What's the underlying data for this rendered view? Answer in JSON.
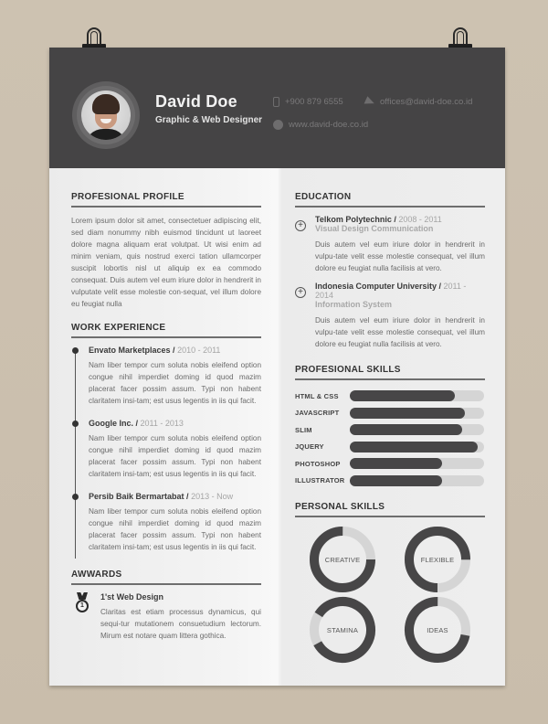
{
  "header": {
    "name": "David Doe",
    "role": "Graphic & Web Designer",
    "phone": "+900 879 6555",
    "email": "offices@david-doe.co.id",
    "website": "www.david-doe.co.id",
    "icons": {
      "phone": "mobile-phone-icon",
      "email": "paper-plane-icon",
      "website": "globe-icon"
    }
  },
  "profile": {
    "title": "PROFESIONAL PROFILE",
    "text": "Lorem ipsum dolor sit amet, consectetuer adipiscing elit, sed diam nonummy nibh euismod tincidunt ut laoreet dolore magna aliquam erat volutpat. Ut wisi enim ad minim veniam, quis nostrud exerci tation ullamcorper suscipit lobortis nisl ut aliquip ex ea commodo consequat. Duis autem vel eum iriure dolor in hendrerit in vulputate velit esse molestie con-sequat, vel illum dolore eu feugiat nulla"
  },
  "work": {
    "title": "WORK EXPERIENCE",
    "items": [
      {
        "company": "Envato Marketplaces",
        "years": "2010 - 2011",
        "text": "Nam liber tempor cum soluta nobis eleifend option congue nihil imperdiet doming id quod mazim placerat facer possim assum. Typi non habent claritatem insi-tam; est usus legentis in iis qui facit."
      },
      {
        "company": "Google Inc.",
        "years": "2011 - 2013",
        "text": "Nam liber tempor cum soluta nobis eleifend option congue nihil imperdiet doming id quod mazim placerat facer possim assum. Typi non habent claritatem insi-tam; est usus legentis in iis qui facit."
      },
      {
        "company": "Persib Baik Bermartabat",
        "years": "2013 - Now",
        "text": "Nam liber tempor cum soluta nobis eleifend option congue nihil imperdiet doming id quod mazim placerat facer possim assum. Typi non habent claritatem insi-tam; est usus legentis in iis qui facit."
      }
    ],
    "separator": " / "
  },
  "awards": {
    "title": "AWWARDS",
    "items": [
      {
        "title": "1'st Web Design",
        "medal_number": "1",
        "text": "Claritas est etiam processus dynamicus, qui sequi-tur mutationem consuetudium lectorum. Mirum est notare quam littera gothica."
      }
    ]
  },
  "education": {
    "title": "EDUCATION",
    "items": [
      {
        "school": "Telkom Polytechnic",
        "years": "2008 - 2011",
        "major": "Visual Design Communication",
        "text": "Duis autem vel eum iriure dolor in hendrerit in vulpu-tate velit esse molestie consequat, vel illum dolore eu feugiat nulla facilisis at vero."
      },
      {
        "school": "Indonesia Computer University",
        "years": "2011 - 2014",
        "major": "Information System",
        "text": "Duis autem vel eum iriure dolor in hendrerit in vulpu-tate velit esse molestie consequat, vel illum dolore eu feugiat nulla facilisis at vero."
      }
    ],
    "expand_symbol": "+"
  },
  "pro_skills": {
    "title": "PROFESIONAL SKILLS",
    "items": [
      {
        "label": "HTML & CSS",
        "level": 0.78
      },
      {
        "label": "JAVASCRIPT",
        "level": 0.86
      },
      {
        "label": "SLIM",
        "level": 0.84
      },
      {
        "label": "JQUERY",
        "level": 0.95
      },
      {
        "label": "PHOTOSHOP",
        "level": 0.69
      },
      {
        "label": "ILLUSTRATOR",
        "level": 0.69
      }
    ]
  },
  "personal_skills": {
    "title": "PERSONAL SKILLS",
    "items": [
      {
        "label": "CREATIVE",
        "level": 0.75,
        "gap_start": 0.0
      },
      {
        "label": "FLEXIBLE",
        "level": 0.75,
        "gap_start": 0.25
      },
      {
        "label": "STAMINA",
        "level": 0.83,
        "gap_start": 0.67
      },
      {
        "label": "IDEAS",
        "level": 0.72,
        "gap_start": 0.0
      }
    ]
  },
  "colors": {
    "header_bg": "#454445",
    "dark": "#474647",
    "track": "#d5d5d5",
    "background": "#cdc2b1"
  }
}
